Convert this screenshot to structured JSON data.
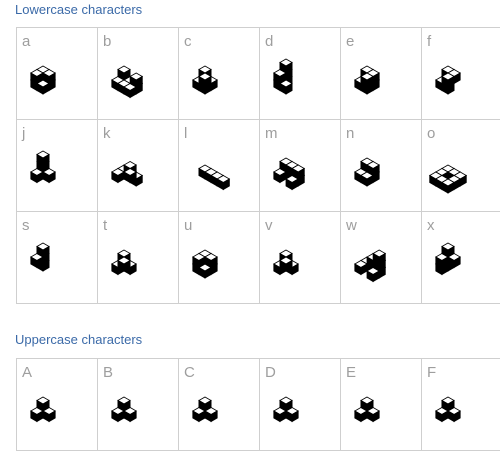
{
  "sections": [
    {
      "title": "Lowercase characters",
      "cells": [
        {
          "char": "a",
          "icon": "isometric-cube-glyph-a"
        },
        {
          "char": "b",
          "icon": "isometric-cube-glyph-b"
        },
        {
          "char": "c",
          "icon": "isometric-cube-glyph-c"
        },
        {
          "char": "d",
          "icon": "isometric-cube-glyph-d"
        },
        {
          "char": "e",
          "icon": "isometric-cube-glyph-e"
        },
        {
          "char": "f",
          "icon": "isometric-cube-glyph-f"
        },
        {
          "char": "j",
          "icon": "isometric-cube-glyph-j"
        },
        {
          "char": "k",
          "icon": "isometric-cube-glyph-k"
        },
        {
          "char": "l",
          "icon": "isometric-cube-glyph-l"
        },
        {
          "char": "m",
          "icon": "isometric-cube-glyph-m"
        },
        {
          "char": "n",
          "icon": "isometric-cube-glyph-n"
        },
        {
          "char": "o",
          "icon": "isometric-cube-glyph-o"
        },
        {
          "char": "s",
          "icon": "isometric-cube-glyph-s"
        },
        {
          "char": "t",
          "icon": "isometric-cube-glyph-t"
        },
        {
          "char": "u",
          "icon": "isometric-cube-glyph-u"
        },
        {
          "char": "v",
          "icon": "isometric-cube-glyph-v"
        },
        {
          "char": "w",
          "icon": "isometric-cube-glyph-w"
        },
        {
          "char": "x",
          "icon": "isometric-cube-glyph-x"
        }
      ]
    },
    {
      "title": "Uppercase characters",
      "cells": [
        {
          "char": "A",
          "icon": "isometric-cube-glyph-A"
        },
        {
          "char": "B",
          "icon": "isometric-cube-glyph-B"
        },
        {
          "char": "C",
          "icon": "isometric-cube-glyph-C"
        },
        {
          "char": "D",
          "icon": "isometric-cube-glyph-D"
        },
        {
          "char": "E",
          "icon": "isometric-cube-glyph-E"
        },
        {
          "char": "F",
          "icon": "isometric-cube-glyph-F"
        }
      ]
    }
  ],
  "colors": {
    "title": "#3b6aa8",
    "grid_border": "#cfcfcf",
    "char_label": "#9e9e9e",
    "cube_dark": "#000000",
    "cube_light": "#ffffff"
  }
}
